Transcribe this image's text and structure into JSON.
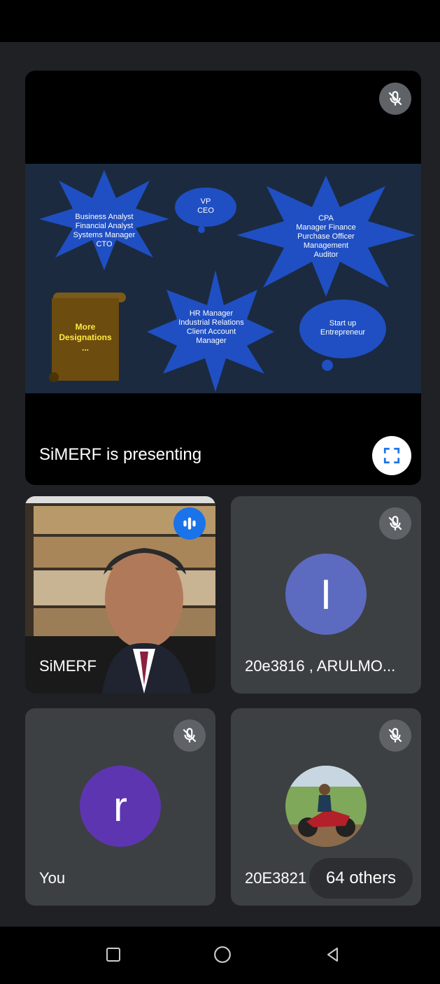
{
  "presentation": {
    "label": "SiMERF is presenting",
    "slide": {
      "burst_1": [
        "Business Analyst",
        "Financial Analyst",
        "Systems Manager",
        "CTO"
      ],
      "cloud_1": [
        "VP",
        "CEO"
      ],
      "burst_2": [
        "CPA",
        "Manager Finance",
        "Purchase Officer",
        "Management",
        "Auditor"
      ],
      "scroll": [
        "More",
        "Designations",
        "..."
      ],
      "burst_3": [
        "HR Manager",
        "Industrial Relations",
        "Client Account",
        "Manager"
      ],
      "cloud_2": [
        "Start up",
        "Entrepreneur"
      ]
    }
  },
  "tiles": [
    {
      "name": "SiMERF",
      "state": "speaking"
    },
    {
      "name": "20e3816 , ARULMO...",
      "initial": "I",
      "avatar_color": "#5c6bc0",
      "state": "muted"
    },
    {
      "name": "You",
      "initial": "r",
      "avatar_color": "#5e35b1",
      "state": "muted"
    },
    {
      "name": "20E3821",
      "state": "muted"
    }
  ],
  "others_label": "64 others",
  "colors": {
    "meet_bg": "#202124",
    "tile_bg": "#3c4043",
    "slide_bg": "#1b2a3e",
    "burst_blue": "#1f4fc2",
    "speaking_blue": "#1a73e8"
  },
  "icons": [
    "mic-off-icon",
    "fullscreen-icon",
    "speaking-icon",
    "nav-recents-icon",
    "nav-home-icon",
    "nav-back-icon"
  ]
}
